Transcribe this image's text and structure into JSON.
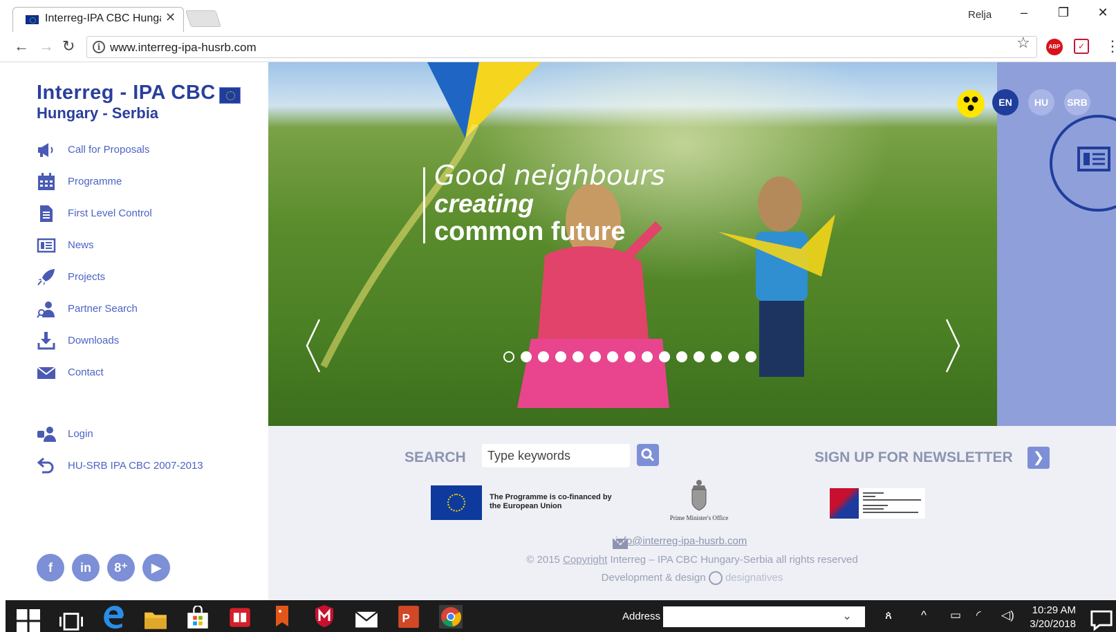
{
  "browser": {
    "tab_title": "Interreg-IPA CBC Hungar",
    "tab_close": "✕",
    "user_label": "Relja",
    "url": "www.interreg-ipa-husrb.com"
  },
  "site": {
    "logo_line1": "Interreg - IPA CBC",
    "logo_line2": "Hungary - Serbia",
    "nav": [
      {
        "label": "Call for Proposals",
        "icon": "megaphone-icon"
      },
      {
        "label": "Programme",
        "icon": "calendar-icon"
      },
      {
        "label": "First Level Control",
        "icon": "document-icon"
      },
      {
        "label": "News",
        "icon": "newspaper-icon"
      },
      {
        "label": "Projects",
        "icon": "rocket-icon"
      },
      {
        "label": "Partner Search",
        "icon": "partner-search-icon"
      },
      {
        "label": "Downloads",
        "icon": "download-icon"
      },
      {
        "label": "Contact",
        "icon": "mail-icon"
      }
    ],
    "login_label": "Login",
    "archive_label": "HU-SRB IPA CBC 2007-2013",
    "social": [
      {
        "name": "facebook",
        "glyph": "f"
      },
      {
        "name": "linkedin",
        "glyph": "in"
      },
      {
        "name": "google-plus",
        "glyph": "8⁺"
      },
      {
        "name": "youtube",
        "glyph": "▶"
      }
    ]
  },
  "hero": {
    "line1": "Good neighbours",
    "line2": "creating",
    "line3": "common future",
    "slide_count": 15,
    "active_slide": 1
  },
  "languages": [
    {
      "code": "EN",
      "active": true,
      "color": "#1f3d9c"
    },
    {
      "code": "HU",
      "active": false,
      "color": "#a9b5e6"
    },
    {
      "code": "SRB",
      "active": false,
      "color": "#a9b5e6"
    }
  ],
  "search": {
    "label": "SEARCH",
    "placeholder": "Type keywords"
  },
  "newsletter": {
    "label": "SIGN UP FOR NEWSLETTER",
    "button_glyph": "❯"
  },
  "partners": {
    "eu_text": "The Programme is co-financed by the European Union",
    "pmo_text": "Prime Minister's Office"
  },
  "footer": {
    "email": "info@interreg-ipa-husrb.com",
    "copyright_prefix": "© 2015",
    "copyright_link": "Copyright",
    "copyright_suffix": "Interreg – IPA CBC Hungary-Serbia all rights reserved",
    "dev_label": "Development & design",
    "dev_brand": "designatives"
  },
  "taskbar": {
    "address_label": "Address",
    "time": "10:29 AM",
    "date": "3/20/2018"
  },
  "colors": {
    "brand": "#2a3f9c",
    "accent": "#7d8fd6",
    "panel": "#8f9fd9"
  }
}
